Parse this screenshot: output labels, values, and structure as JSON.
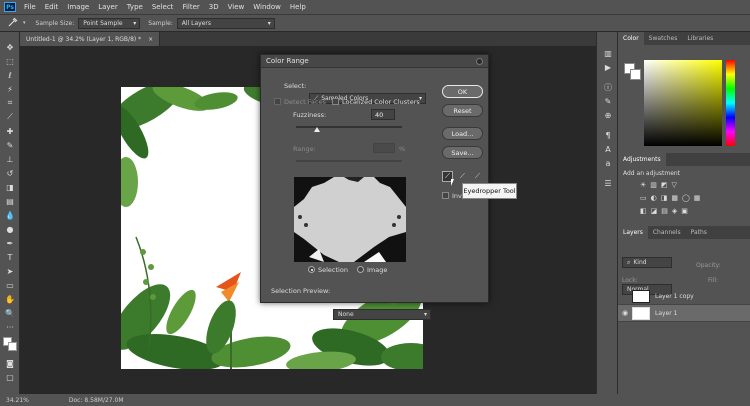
{
  "menubar": {
    "logo": "Ps",
    "items": [
      "File",
      "Edit",
      "Image",
      "Layer",
      "Type",
      "Select",
      "Filter",
      "3D",
      "View",
      "Window",
      "Help"
    ]
  },
  "options": {
    "sample_size_label": "Sample Size:",
    "sample_size_value": "Point Sample",
    "sample_label": "Sample:",
    "sample_value": "All Layers"
  },
  "document": {
    "tab_title": "Untitled-1 @ 34.2% (Layer 1, RGB/8) *",
    "close": "×"
  },
  "status": {
    "zoom": "34.21%",
    "doc": "Doc: 8.58M/27.0M"
  },
  "dialog": {
    "title": "Color Range",
    "select_label": "Select:",
    "select_value": "Sampled Colors",
    "detect_faces": "Detect Faces",
    "localized_clusters": "Localized Color Clusters",
    "fuzziness_label": "Fuzziness:",
    "fuzziness_value": "40",
    "fuzziness_level": 0.2,
    "range_label": "Range:",
    "range_unit": "%",
    "radio_selection": "Selection",
    "radio_image": "Image",
    "preview_label": "Selection Preview:",
    "preview_value": "None",
    "buttons": {
      "ok": "OK",
      "reset": "Reset",
      "load": "Load...",
      "save": "Save..."
    },
    "invert": "Inv"
  },
  "tooltip": "Eyedropper Tool",
  "panels": {
    "color_tabs": [
      "Color",
      "Swatches",
      "Libraries"
    ],
    "adjustments_tab": "Adjustments",
    "add_adjustment": "Add an adjustment",
    "layers_tabs": [
      "Layers",
      "Channels",
      "Paths"
    ],
    "kind": "Kind",
    "blend": "Normal",
    "opacity_label": "Opacity:",
    "fill_label": "Fill:",
    "lock_label": "Lock:",
    "layers": [
      {
        "name": "Layer 1 copy",
        "visible": false
      },
      {
        "name": "Layer 1",
        "visible": true
      }
    ]
  },
  "colors": {
    "ui": "#535353",
    "accent": "#31a8ff"
  }
}
